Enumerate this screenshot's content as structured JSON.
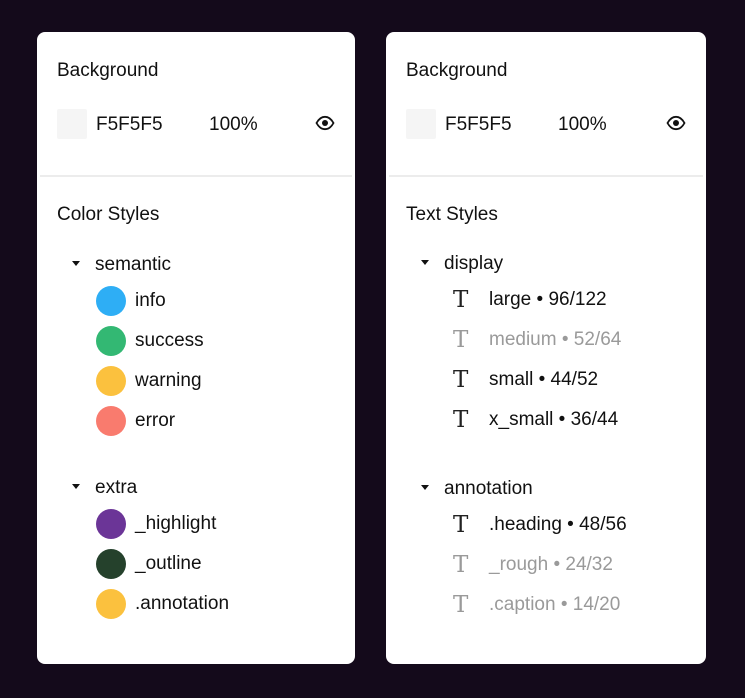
{
  "left_panel": {
    "background_title": "Background",
    "background_hex": "F5F5F5",
    "background_opacity": "100%",
    "styles_title": "Color Styles",
    "groups": [
      {
        "label": "semantic",
        "items": [
          {
            "label": "info",
            "color": "#2eaef5"
          },
          {
            "label": "success",
            "color": "#33b873"
          },
          {
            "label": "warning",
            "color": "#fbc13e"
          },
          {
            "label": "error",
            "color": "#f97b6e"
          }
        ]
      },
      {
        "label": "extra",
        "items": [
          {
            "label": "_highlight",
            "color": "#6b3597"
          },
          {
            "label": "_outline",
            "color": "#25412c"
          },
          {
            "label": ".annotation",
            "color": "#fbc13e"
          }
        ]
      }
    ]
  },
  "right_panel": {
    "background_title": "Background",
    "background_hex": "F5F5F5",
    "background_opacity": "100%",
    "styles_title": "Text Styles",
    "groups": [
      {
        "label": "display",
        "items": [
          {
            "label": "large • 96/122",
            "muted": false
          },
          {
            "label": "medium • 52/64",
            "muted": true
          },
          {
            "label": "small • 44/52",
            "muted": false
          },
          {
            "label": "x_small • 36/44",
            "muted": false
          }
        ]
      },
      {
        "label": "annotation",
        "items": [
          {
            "label": ".heading • 48/56",
            "muted": false
          },
          {
            "label": "_rough • 24/32",
            "muted": true
          },
          {
            "label": ".caption • 14/20",
            "muted": true
          }
        ]
      }
    ]
  },
  "icons": {
    "eye": "eye-icon",
    "caret": "caret-down-icon",
    "text_style": "text-style-icon"
  },
  "colors": {
    "page_background": "#140a1b",
    "panel_background": "#ffffff",
    "swatch": "#F5F5F5"
  }
}
